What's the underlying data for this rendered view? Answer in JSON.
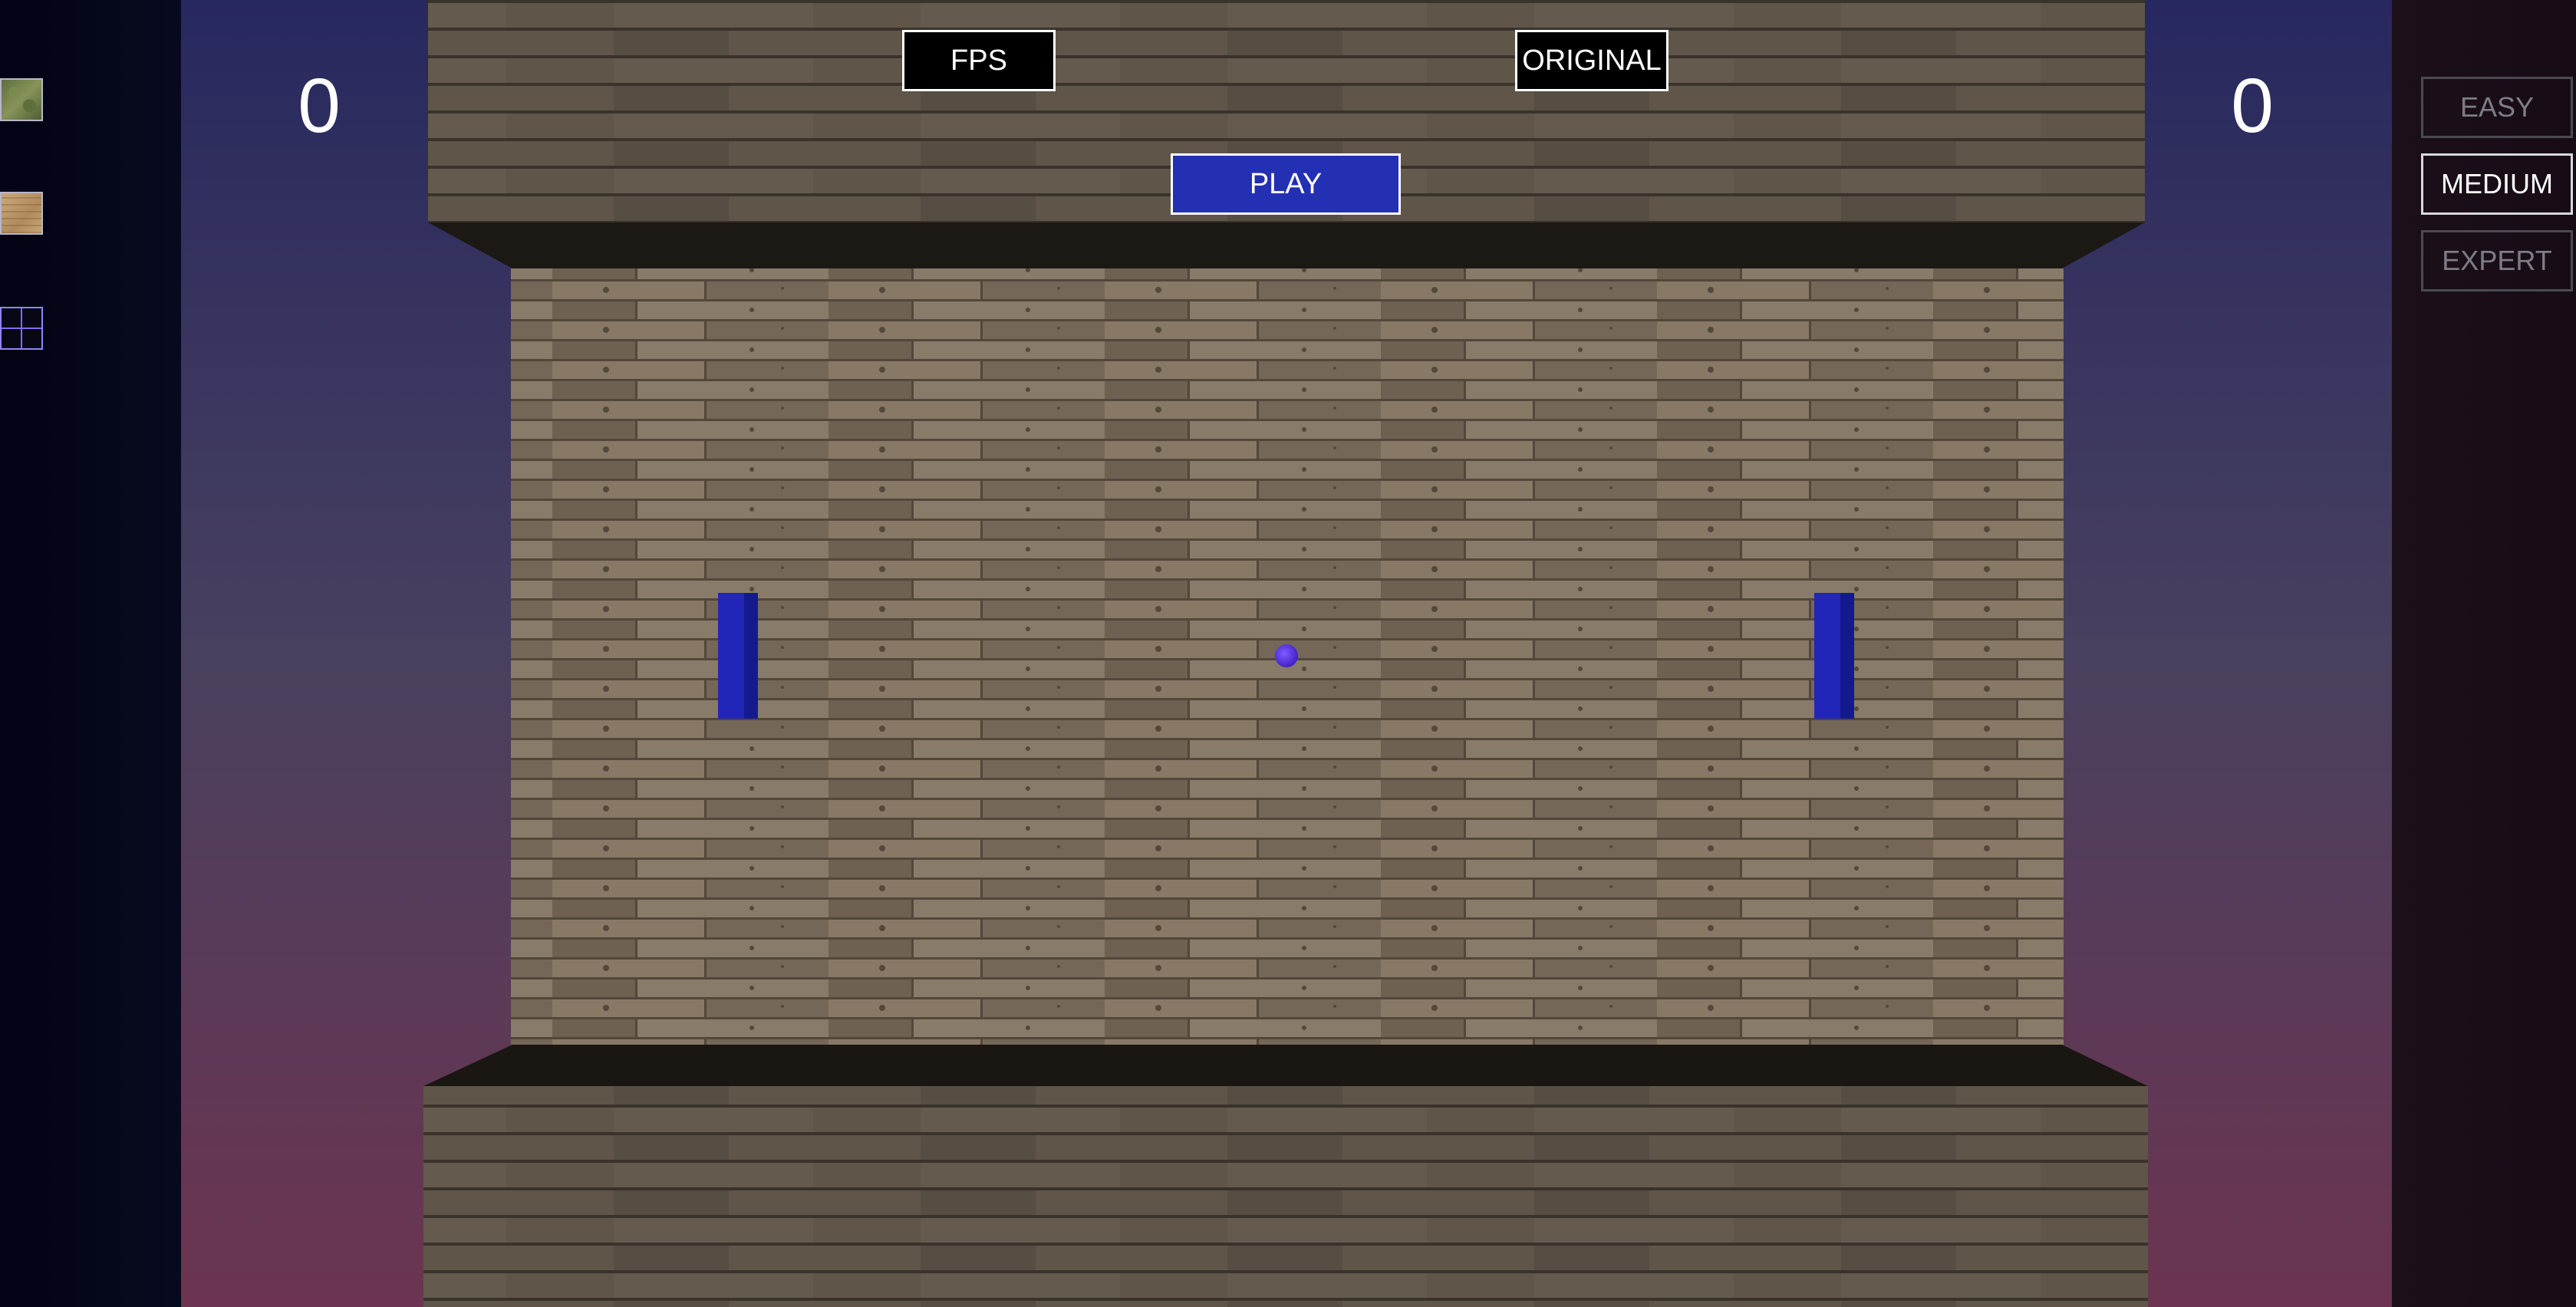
{
  "scores": {
    "left": "0",
    "right": "0"
  },
  "view_buttons": {
    "fps": "FPS",
    "original": "ORIGINAL"
  },
  "play_label": "PLAY",
  "difficulty": {
    "options": [
      "EASY",
      "MEDIUM",
      "EXPERT"
    ],
    "selected": "MEDIUM"
  },
  "texture_options": [
    "grass",
    "wood",
    "grid"
  ],
  "colors": {
    "paddle": "#2126b8",
    "ball": "#5a35e8",
    "play_button": "#2330b4",
    "background_top": "#2a2c64",
    "background_bottom": "#6b3350"
  }
}
